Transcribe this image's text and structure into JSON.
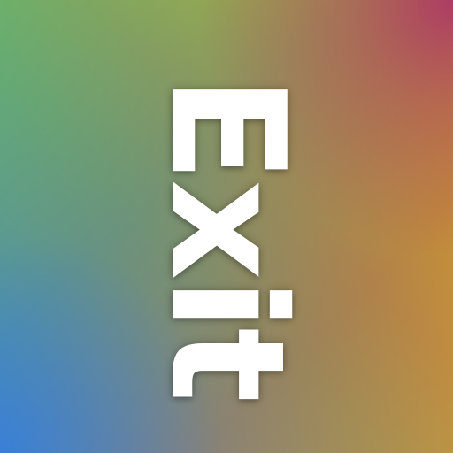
{
  "label": "Exit",
  "colors": {
    "text": "#ffffff",
    "top_left": "#58d268",
    "top_right": "#a8305e",
    "bottom_left": "#2a86f0",
    "bottom_right": "#f6c800"
  }
}
